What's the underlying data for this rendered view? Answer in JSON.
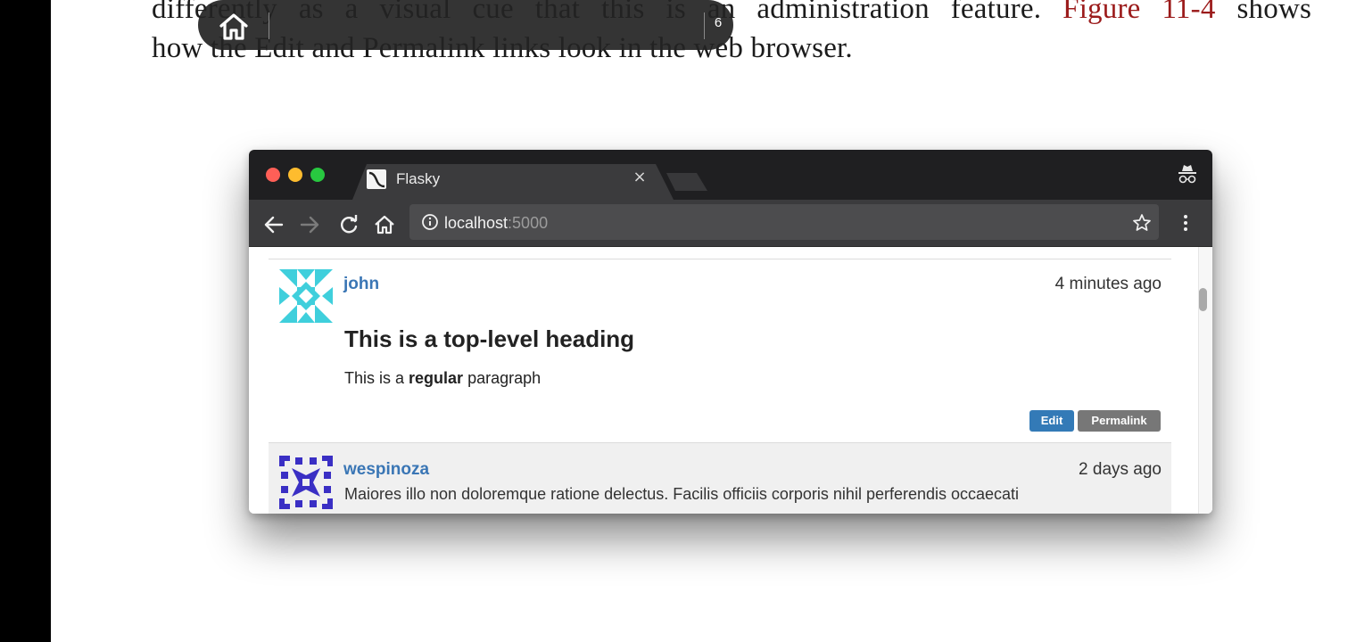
{
  "book": {
    "line1": {
      "prefix": "differently as a visual cue that this is an administration feature.",
      "figure_ref": "Figure 11-4",
      "suffix": "shows"
    },
    "line2": "how the Edit and Permalink links look in the web browser."
  },
  "reader": {
    "home_icon": "home-icon",
    "page_number": "6"
  },
  "browser": {
    "tab_title": "Flasky",
    "tab_close": "×",
    "url_host": "localhost",
    "url_port": ":5000",
    "icons": [
      "back-arrow-icon",
      "forward-arrow-icon",
      "reload-icon",
      "home-icon",
      "info-icon",
      "bookmark-star-icon",
      "menu-dots-icon",
      "incognito-icon"
    ]
  },
  "posts": [
    {
      "author": "john",
      "timestamp": "4 minutes ago",
      "heading": "This is a top-level heading",
      "paragraph_before": "This is a ",
      "paragraph_bold": "regular",
      "paragraph_after": " paragraph",
      "buttons": {
        "edit": "Edit",
        "permalink": "Permalink"
      },
      "avatar_color": "#3fcfdc"
    },
    {
      "author": "wespinoza",
      "timestamp": "2 days ago",
      "body": "Maiores illo non doloremque ratione delectus. Facilis officiis corporis nihil perferendis occaecati",
      "avatar_color": "#3a2fc4"
    }
  ],
  "colors": {
    "link": "#3a76b5",
    "edit_button": "#337ab7",
    "permalink_button": "#777777",
    "xref": "#9b1b1b"
  }
}
